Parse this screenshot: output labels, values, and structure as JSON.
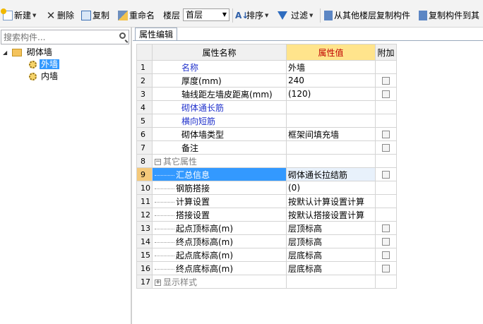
{
  "toolbar": {
    "new_label": "新建",
    "delete_label": "删除",
    "copy_label": "复制",
    "rename_label": "重命名",
    "floor_label": "楼层",
    "floor_value": "首层",
    "sort_label": "排序",
    "filter_label": "过滤",
    "copy_from_floor_label": "从其他楼层复制构件",
    "copy_to_label": "复制构件到其"
  },
  "left_panel": {
    "search_placeholder": "搜索构件...",
    "tree": {
      "root_label": "砌体墙",
      "children": [
        {
          "label": "外墙",
          "selected": true
        },
        {
          "label": "内墙",
          "selected": false
        }
      ]
    }
  },
  "right_panel": {
    "tab_label": "属性编辑",
    "columns": {
      "name": "属性名称",
      "value": "属性值",
      "extra": "附加"
    },
    "rows": [
      {
        "num": "1",
        "name": "名称",
        "value": "外墙"
      },
      {
        "num": "2",
        "name": "厚度(mm)",
        "value": "240"
      },
      {
        "num": "3",
        "name": "轴线距左墙皮距离(mm)",
        "value": "(120)"
      },
      {
        "num": "4",
        "name": "砌体通长筋",
        "value": ""
      },
      {
        "num": "5",
        "name": "横向短筋",
        "value": ""
      },
      {
        "num": "6",
        "name": "砌体墙类型",
        "value": "框架间填充墙"
      },
      {
        "num": "7",
        "name": "备注",
        "value": ""
      },
      {
        "num": "8",
        "name": "其它属性",
        "value": ""
      },
      {
        "num": "9",
        "name": "汇总信息",
        "value": "砌体通长拉结筋"
      },
      {
        "num": "10",
        "name": "钢筋搭接",
        "value": "(0)"
      },
      {
        "num": "11",
        "name": "计算设置",
        "value": "按默认计算设置计算"
      },
      {
        "num": "12",
        "name": "搭接设置",
        "value": "按默认搭接设置计算"
      },
      {
        "num": "13",
        "name": "起点顶标高(m)",
        "value": "层顶标高"
      },
      {
        "num": "14",
        "name": "终点顶标高(m)",
        "value": "层顶标高"
      },
      {
        "num": "15",
        "name": "起点底标高(m)",
        "value": "层底标高"
      },
      {
        "num": "16",
        "name": "终点底标高(m)",
        "value": "层底标高"
      },
      {
        "num": "17",
        "name": "显示样式",
        "value": ""
      }
    ]
  }
}
